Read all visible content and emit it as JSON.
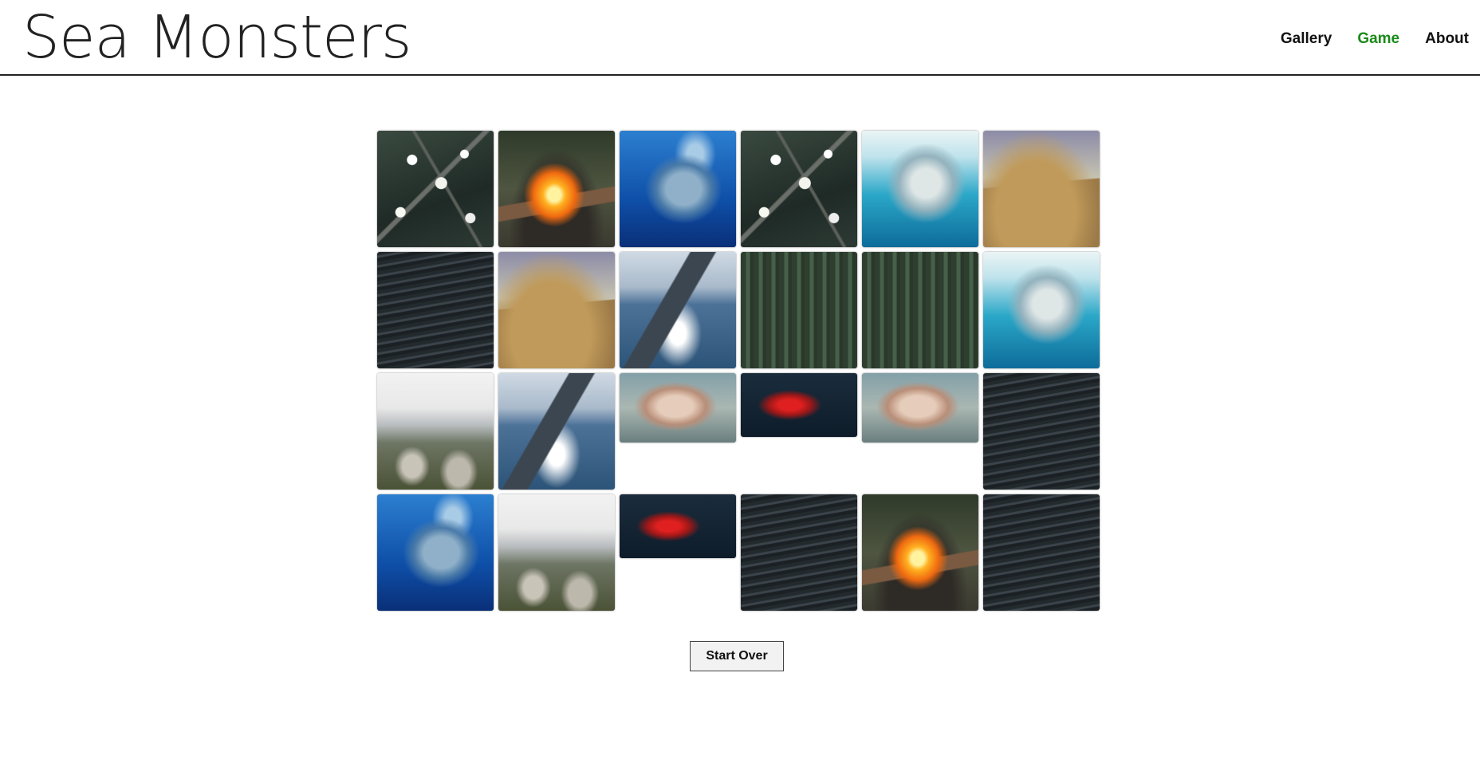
{
  "site": {
    "title": "Sea Monsters"
  },
  "nav": {
    "items": [
      "Gallery",
      "Game",
      "About"
    ],
    "active": "Game"
  },
  "board": {
    "tiles": [
      {
        "image": "blossom"
      },
      {
        "image": "fire"
      },
      {
        "image": "mosasaur"
      },
      {
        "image": "blossom"
      },
      {
        "image": "angel-creature"
      },
      {
        "image": "dune"
      },
      {
        "image": "waves"
      },
      {
        "image": "dune"
      },
      {
        "image": "whale"
      },
      {
        "image": "forest"
      },
      {
        "image": "forest"
      },
      {
        "image": "angel-creature"
      },
      {
        "image": "snow-rocks"
      },
      {
        "image": "whale"
      },
      {
        "image": "carcass"
      },
      {
        "image": "red-fish"
      },
      {
        "image": "carcass"
      },
      {
        "image": "waves"
      },
      {
        "image": "mosasaur"
      },
      {
        "image": "snow-rocks"
      },
      {
        "image": "red-fish"
      },
      {
        "image": "waves"
      },
      {
        "image": "fire"
      },
      {
        "image": "waves"
      }
    ]
  },
  "actions": {
    "start_over_label": "Start Over"
  },
  "colors": {
    "nav_active": "#1a8a1a",
    "header_rule": "#222222"
  }
}
